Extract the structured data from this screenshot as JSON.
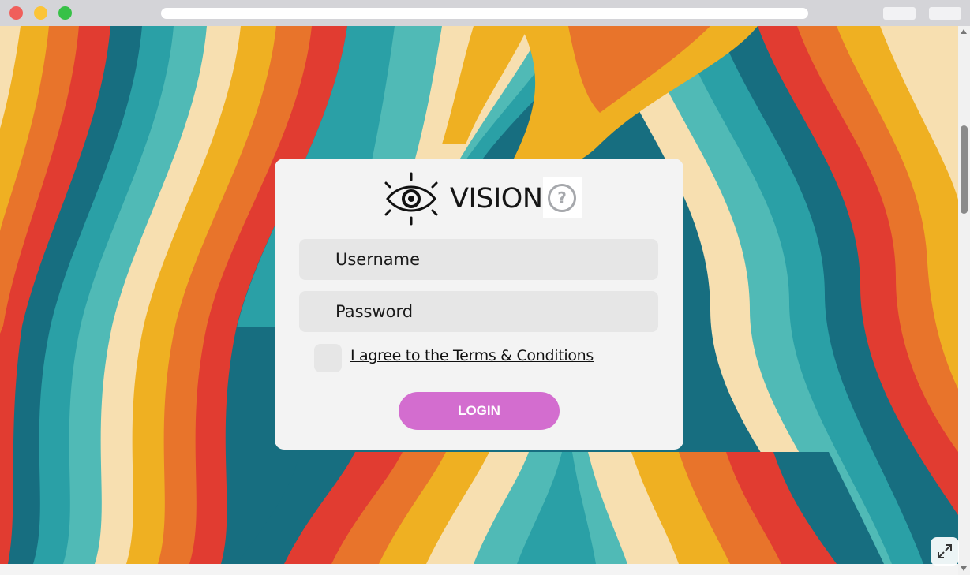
{
  "brand": {
    "name": "VISION",
    "logo_icon": "eye-icon",
    "help_icon": "question-circle-icon"
  },
  "form": {
    "username_placeholder": "Username",
    "password_placeholder": "Password",
    "terms_label": "I agree to the Terms & Conditions",
    "login_label": "LOGIN"
  },
  "colors": {
    "accent": "#d36dcf",
    "field_bg": "#e6e6e6",
    "card_bg": "#f3f3f3",
    "wave_palette": [
      "#176e80",
      "#2aa0a6",
      "#50bab6",
      "#f7dfb0",
      "#efb022",
      "#e8742b",
      "#e13c31"
    ]
  },
  "browser": {
    "window_buttons": [
      "close",
      "minimize",
      "maximize"
    ],
    "fullscreen_icon": "expand-arrows-icon"
  }
}
